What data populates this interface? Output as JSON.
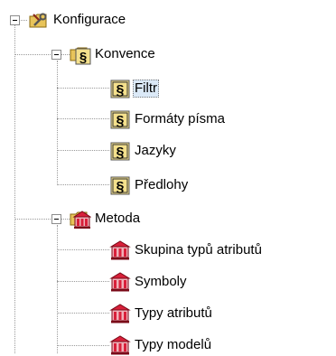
{
  "tree": {
    "root": {
      "label": "Konfigurace",
      "icon": "wrench-folder-icon",
      "expanded": true
    },
    "groups": [
      {
        "label": "Konvence",
        "icon": "convention-folder-icon",
        "expanded": true,
        "items": [
          {
            "label": "Filtr",
            "icon": "convention-item-icon",
            "selected": true
          },
          {
            "label": "Formáty písma",
            "icon": "convention-item-icon",
            "selected": false
          },
          {
            "label": "Jazyky",
            "icon": "convention-item-icon",
            "selected": false
          },
          {
            "label": "Předlohy",
            "icon": "convention-item-icon",
            "selected": false
          }
        ]
      },
      {
        "label": "Metoda",
        "icon": "method-folder-icon",
        "expanded": true,
        "items": [
          {
            "label": "Skupina typů atributů",
            "icon": "method-item-icon",
            "selected": false
          },
          {
            "label": "Symboly",
            "icon": "method-item-icon",
            "selected": false
          },
          {
            "label": "Typy atributů",
            "icon": "method-item-icon",
            "selected": false
          },
          {
            "label": "Typy modelů",
            "icon": "method-item-icon",
            "selected": false
          }
        ]
      }
    ]
  }
}
